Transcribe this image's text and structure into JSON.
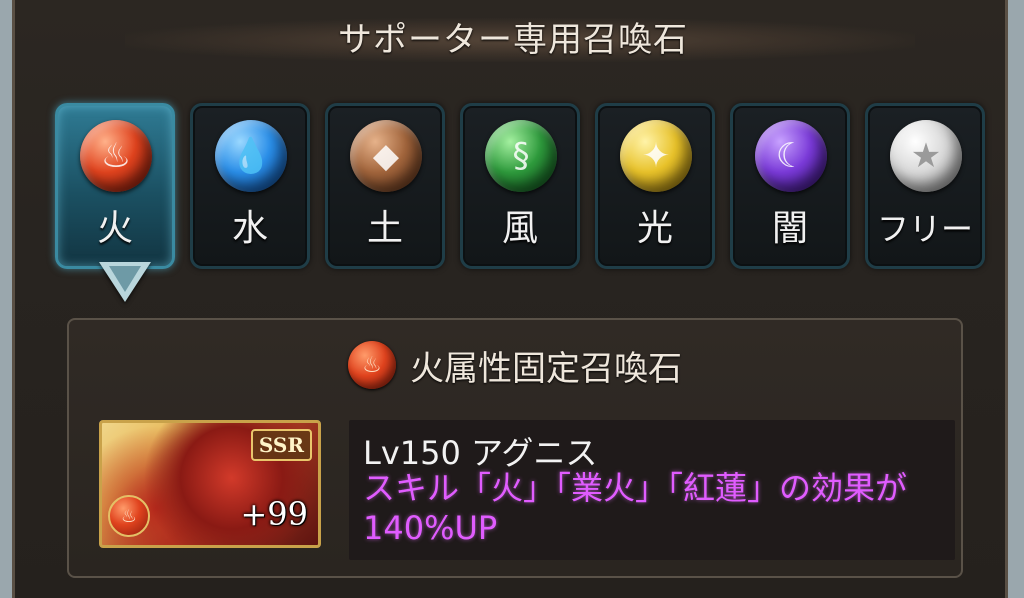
{
  "header": {
    "title": "サポーター専用召喚石"
  },
  "tabs": [
    {
      "label": "火",
      "icon": "fire-orb-icon",
      "color": "#e0431e",
      "active": true
    },
    {
      "label": "水",
      "icon": "water-orb-icon",
      "color": "#2a8ee8",
      "active": false
    },
    {
      "label": "土",
      "icon": "earth-orb-icon",
      "color": "#a2653c",
      "active": false
    },
    {
      "label": "風",
      "icon": "wind-orb-icon",
      "color": "#2e9a3c",
      "active": false
    },
    {
      "label": "光",
      "icon": "light-orb-icon",
      "color": "#e8c22a",
      "active": false
    },
    {
      "label": "闇",
      "icon": "dark-orb-icon",
      "color": "#7a3ad8",
      "active": false
    },
    {
      "label": "フリー",
      "icon": "free-star-orb-icon",
      "color": "#d8d8d8",
      "active": false
    }
  ],
  "fixed": {
    "title": "火属性固定召喚石",
    "summon": {
      "rarity": "SSR",
      "plus": "+99",
      "name": "Lv150 アグニス",
      "description": "スキル「火」「業火」「紅蓮」の効果が140%UP"
    }
  },
  "colors": {
    "panel_bg": "#2a2520",
    "active_tab": "#2f7b94",
    "skill_text": "#e05cff"
  }
}
